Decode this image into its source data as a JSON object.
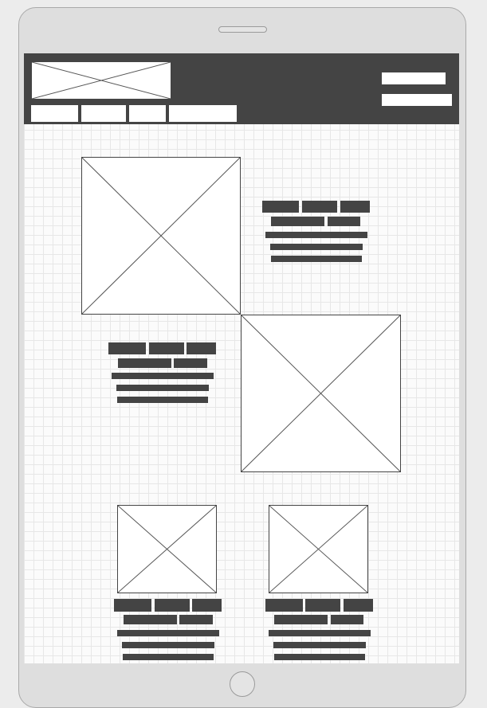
{
  "device": {
    "type": "tablet-portrait",
    "screen_background": "#fbfbfb",
    "frame_color": "#dedede",
    "accent_dark": "#444444"
  },
  "header": {
    "logo": "image-placeholder-icon",
    "nav_items": [
      "",
      "",
      "",
      ""
    ],
    "right_controls": [
      "",
      ""
    ]
  },
  "content": {
    "sections": [
      {
        "image": "image-placeholder-icon",
        "text_placeholder_lines": 5
      },
      {
        "image": "image-placeholder-icon",
        "text_placeholder_lines": 5
      }
    ],
    "cards": [
      {
        "image": "image-placeholder-icon",
        "text_placeholder_lines": 5
      },
      {
        "image": "image-placeholder-icon",
        "text_placeholder_lines": 5
      }
    ]
  }
}
